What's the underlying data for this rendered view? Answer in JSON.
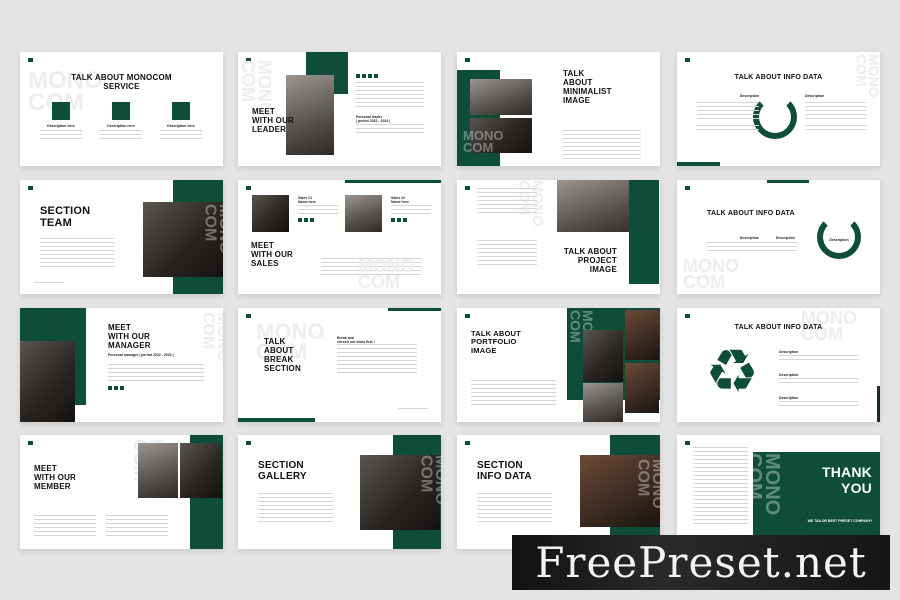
{
  "colors": {
    "accent": "#0d4d3a",
    "background": "#e4e4e4",
    "slide": "#ffffff"
  },
  "brand": "MONO\nCOM",
  "slides": [
    {
      "name": "service",
      "title": "TALK ABOUT MONOCOM\nSERVICE",
      "labels": [
        "Description here",
        "Description here",
        "Description here"
      ],
      "icons": [
        "user-icon",
        "pen-icon",
        "truck-icon"
      ]
    },
    {
      "name": "leader",
      "title": "MEET\nWITH OUR\nLEADER",
      "labels": [
        "Personal leader\n| period 2022 - 2024 |"
      ]
    },
    {
      "name": "minimalist-image",
      "title": "TALK\nABOUT\nMINIMALIST\nIMAGE"
    },
    {
      "name": "info-data-1",
      "title": "TALK ABOUT INFO DATA",
      "labels": [
        "Description",
        "Description",
        "Description"
      ]
    },
    {
      "name": "section-team",
      "title": "SECTION\nTEAM"
    },
    {
      "name": "sales",
      "title": "MEET\nWITH OUR\nSALES",
      "labels": [
        "Sales #1\nName here",
        "Sales #2\nName here"
      ]
    },
    {
      "name": "project-image",
      "title": "TALK ABOUT\nPROJECT\nIMAGE"
    },
    {
      "name": "info-data-2",
      "title": "TALK ABOUT INFO DATA",
      "labels": [
        "Description",
        "Description",
        "Description"
      ]
    },
    {
      "name": "manager",
      "title": "MEET\nWITH OUR\nMANAGER",
      "labels": [
        "Personal manager | period 2022 - 2024 |"
      ]
    },
    {
      "name": "break-section",
      "title": "TALK\nABOUT\nBREAK\nSECTION",
      "labels": [
        "Break and\nrefresh our brain first !"
      ]
    },
    {
      "name": "portfolio-image",
      "title": "TALK ABOUT\nPORTFOLIO\nIMAGE"
    },
    {
      "name": "info-data-3",
      "title": "TALK ABOUT INFO DATA",
      "labels": [
        "Description",
        "Description",
        "Description"
      ]
    },
    {
      "name": "member",
      "title": "MEET\nWITH OUR\nMEMBER"
    },
    {
      "name": "section-gallery",
      "title": "SECTION\nGALLERY"
    },
    {
      "name": "section-info-data",
      "title": "SECTION\nINFO DATA"
    },
    {
      "name": "thank-you",
      "title": "THANK\nYOU",
      "labels": [
        "WE TAILOR BEST PRESET COMPANY!"
      ]
    }
  ],
  "watermark": "FreePreset.net"
}
